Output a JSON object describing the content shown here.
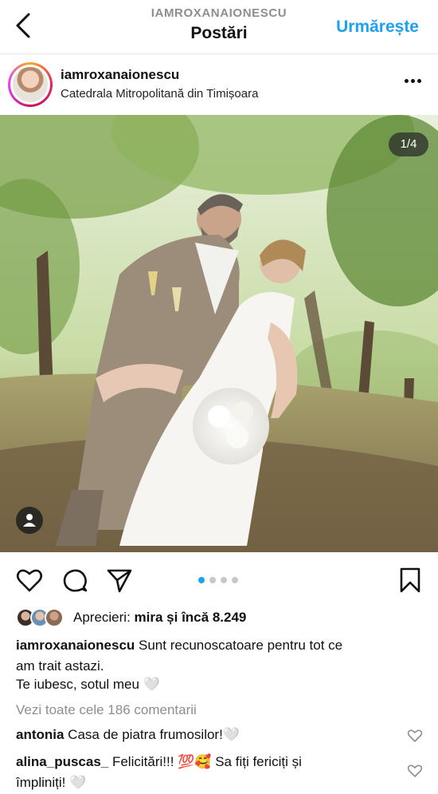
{
  "header": {
    "username": "IAMROXANAIONESCU",
    "title": "Postări",
    "follow_label": "Urmărește"
  },
  "post": {
    "username": "iamroxanaionescu",
    "location": "Catedrala Mitropolitană din Timișoara",
    "image_counter": "1/4",
    "carousel": {
      "current": 1,
      "total": 4
    }
  },
  "likes": {
    "prefix": "Aprecieri: ",
    "name": "mira",
    "middle": " și ",
    "more": "încă 8.249"
  },
  "caption": {
    "username": "iamroxanaionescu",
    "line1": " Sunt recunoscatoare pentru tot ce",
    "line2": "am trait astazi.",
    "line3": "Te iubesc, sotul meu 🤍"
  },
  "view_all_comments": "Vezi toate cele 186 comentarii",
  "comments": [
    {
      "username": "antonia",
      "text": " Casa de piatra frumosilor!🤍"
    },
    {
      "username": "alina_puscas_",
      "text": " Felicitări!!! 💯🥰 Sa fiți fericiți și",
      "text2": "împliniți! 🤍"
    }
  ],
  "colors": {
    "accent": "#1da1f2",
    "muted": "#8e8e8e"
  },
  "icons": [
    "back-icon",
    "more-options-icon",
    "user-tag-icon",
    "heart-icon",
    "comment-icon",
    "share-icon",
    "bookmark-icon",
    "small-heart-icon"
  ]
}
